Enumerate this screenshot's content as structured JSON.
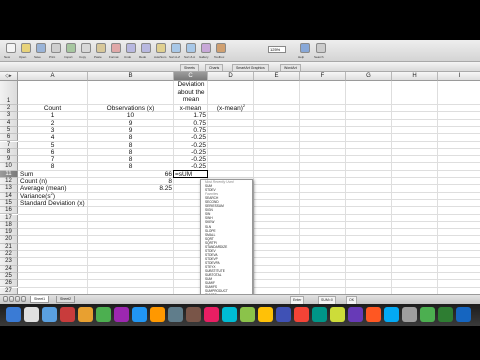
{
  "toolbar": {
    "buttons": [
      {
        "name": "new-button",
        "label": "New",
        "color": "#f4f4f4"
      },
      {
        "name": "open-button",
        "label": "Open",
        "color": "#e8d37a"
      },
      {
        "name": "save-button",
        "label": "Save",
        "color": "#9ab4d8"
      },
      {
        "name": "print-button",
        "label": "Print",
        "color": "#cfcfcf"
      },
      {
        "name": "import-button",
        "label": "Import",
        "color": "#a7c7a0"
      },
      {
        "name": "copy-button",
        "label": "Copy",
        "color": "#d8d8d8"
      },
      {
        "name": "paste-button",
        "label": "Paste",
        "color": "#d8c89a"
      },
      {
        "name": "format-button",
        "label": "Format",
        "color": "#e0a8a8"
      },
      {
        "name": "undo-button",
        "label": "Undo",
        "color": "#b8b8e0"
      },
      {
        "name": "redo-button",
        "label": "Redo",
        "color": "#b8b8e0"
      },
      {
        "name": "autosum-button",
        "label": "AutoSum",
        "color": "#e0d090"
      },
      {
        "name": "sort-az-button",
        "label": "Sort A-Z",
        "color": "#a8c8e8"
      },
      {
        "name": "sort-za-button",
        "label": "Sort Z-A",
        "color": "#a8c8e8"
      },
      {
        "name": "gallery-button",
        "label": "Gallery",
        "color": "#c8a8d8"
      },
      {
        "name": "toolbox-button",
        "label": "Toolbox",
        "color": "#d0a070"
      }
    ],
    "zoom": "125%",
    "right_buttons": [
      {
        "name": "help-button",
        "label": "Help",
        "color": "#88a8d8"
      },
      {
        "name": "search-button",
        "label": "Search",
        "color": "#cccccc"
      }
    ]
  },
  "ribbon": {
    "tabs": [
      "Sheets",
      "Charts",
      "SmartArt Graphics",
      "WordArt"
    ]
  },
  "columns": [
    "A",
    "B",
    "C",
    "D",
    "E",
    "F",
    "G",
    "H",
    "I"
  ],
  "selected_column": "C",
  "rows": [
    "1",
    "2",
    "3",
    "4",
    "5",
    "6",
    "7",
    "8",
    "9",
    "10",
    "11",
    "12",
    "13",
    "14",
    "15",
    "16",
    "17",
    "18",
    "19",
    "20",
    "21",
    "22",
    "23",
    "24",
    "25",
    "26",
    "27",
    "28",
    "29",
    "30"
  ],
  "selected_row": "11",
  "cells": {
    "C1_line1": "Deviation",
    "C1_line2": "about the",
    "C1_line3": "mean",
    "A2": "Count",
    "B2": "Observations (x)",
    "C2": "x-mean",
    "D2": "(x-mean)",
    "D2_sup": "2",
    "count": [
      "1",
      "2",
      "3",
      "4",
      "5",
      "6",
      "7",
      "8"
    ],
    "observations": [
      "10",
      "9",
      "9",
      "8",
      "8",
      "8",
      "8",
      "8"
    ],
    "deviation": [
      "1.75",
      "0.75",
      "0.75",
      "-0.25",
      "-0.25",
      "-0.25",
      "-0.25",
      "-0.25"
    ],
    "A11": "Sum",
    "B11": "66",
    "C11": "=sUM",
    "A12": "Count (n)",
    "B12": "8",
    "A13": "Average (mean)",
    "B13": "8.25",
    "A14": "Variance(s",
    "A14_sup": "2",
    "A14_end": ")",
    "A15": "Standard Deviation (x)"
  },
  "dropdown": {
    "items": [
      {
        "text": "Most Recently Used",
        "head": true
      },
      {
        "text": "SUM",
        "head": false
      },
      {
        "text": "STDEV",
        "head": false
      },
      {
        "text": "Favorites",
        "head": true
      },
      {
        "text": "SEARCH",
        "head": false
      },
      {
        "text": "SECOND",
        "head": false
      },
      {
        "text": "SERIESSUM",
        "head": false
      },
      {
        "text": "SIGN",
        "head": false
      },
      {
        "text": "SIN",
        "head": false
      },
      {
        "text": "SINH",
        "head": false
      },
      {
        "text": "SKEW",
        "head": false
      },
      {
        "text": "SLN",
        "head": false
      },
      {
        "text": "SLOPE",
        "head": false
      },
      {
        "text": "SMALL",
        "head": false
      },
      {
        "text": "SQRT",
        "head": false
      },
      {
        "text": "SQRTPI",
        "head": false
      },
      {
        "text": "STANDARDIZE",
        "head": false
      },
      {
        "text": "STDEV",
        "head": false
      },
      {
        "text": "STDEVA",
        "head": false
      },
      {
        "text": "STDEVP",
        "head": false
      },
      {
        "text": "STDEVPA",
        "head": false
      },
      {
        "text": "STEYX",
        "head": false
      },
      {
        "text": "SUBSTITUTE",
        "head": false
      },
      {
        "text": "SUBTOTAL",
        "head": false
      },
      {
        "text": "SUM",
        "head": false
      },
      {
        "text": "SUMIF",
        "head": false
      },
      {
        "text": "SUMIFS",
        "head": false
      },
      {
        "text": "SUMPRODUCT",
        "head": false
      },
      {
        "text": "SUMSQ",
        "head": false
      },
      {
        "text": "SUMX2MY2",
        "head": false
      },
      {
        "text": "SUMX2PY2",
        "head": false
      },
      {
        "text": "SUMXMY2",
        "head": false
      },
      {
        "text": "SYD",
        "head": false
      }
    ]
  },
  "sheet_tabs": [
    "Sheet1",
    "Sheet2"
  ],
  "status": {
    "view": "Normal View",
    "mode": "Enter",
    "sum": "SUM=0",
    "extra": "OK"
  },
  "dock_colors": [
    "#3a7bd5",
    "#e0e0e0",
    "#5aa0e0",
    "#c83c3c",
    "#e8a030",
    "#4caf50",
    "#9c27b0",
    "#2196f3",
    "#ff9800",
    "#607d8b",
    "#795548",
    "#e91e63",
    "#00bcd4",
    "#8bc34a",
    "#ffc107",
    "#3f51b5",
    "#f44336",
    "#009688",
    "#cddc39",
    "#673ab7",
    "#ff5722",
    "#03a9f4",
    "#9e9e9e",
    "#4caf50",
    "#2e7d32",
    "#1565c0"
  ]
}
